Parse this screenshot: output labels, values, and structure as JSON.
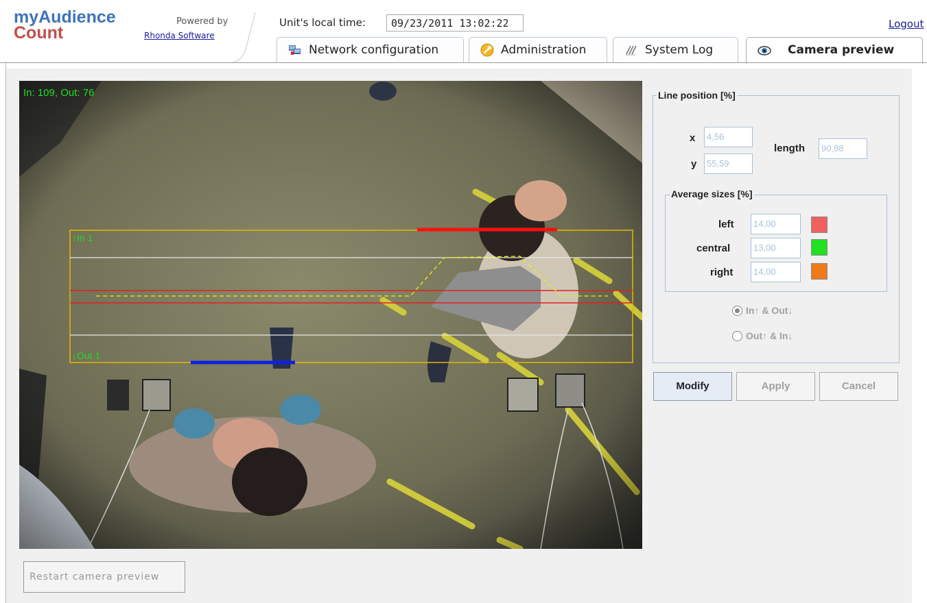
{
  "brand": {
    "line1": "myAudience",
    "line2": "Count",
    "powered_by": "Powered by",
    "vendor": "Rhonda Software"
  },
  "header": {
    "time_label": "Unit's local time:",
    "time_value": "09/23/2011 13:02:22",
    "logout": "Logout"
  },
  "tabs": [
    {
      "label": "Network configuration",
      "icon": "network-icon",
      "active": false
    },
    {
      "label": "Administration",
      "icon": "wrench-icon",
      "active": false
    },
    {
      "label": "System Log",
      "icon": "log-icon",
      "active": false
    },
    {
      "label": "Camera preview",
      "icon": "eye-icon",
      "active": true
    }
  ],
  "video": {
    "counts": "In: 109, Out: 76",
    "in_label": "↑In 1",
    "out_label": "↓Out 1"
  },
  "panel": {
    "line_position_legend": "Line position [%]",
    "x_label": "x",
    "x_value": "4,56",
    "y_label": "y",
    "y_value": "55,59",
    "length_label": "length",
    "length_value": "90,88",
    "avg_legend": "Average sizes [%]",
    "sizes": [
      {
        "label": "left",
        "value": "14,00",
        "color": "#f06060"
      },
      {
        "label": "central",
        "value": "13,00",
        "color": "#22e022"
      },
      {
        "label": "right",
        "value": "14,00",
        "color": "#f07a1a"
      }
    ],
    "radio1": "In↑ & Out↓",
    "radio1_checked": true,
    "radio2": "Out↑ & In↓",
    "radio2_checked": false
  },
  "buttons": {
    "modify": "Modify",
    "apply": "Apply",
    "cancel": "Cancel",
    "restart": "Restart camera preview"
  }
}
